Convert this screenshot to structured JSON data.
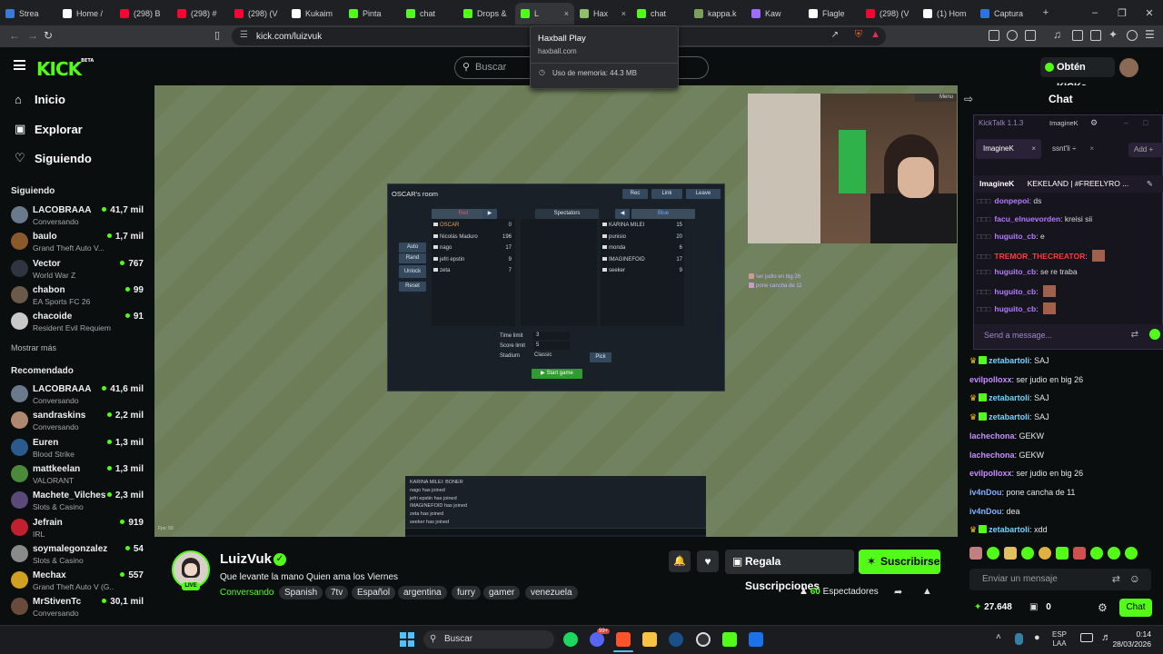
{
  "browser": {
    "tabs": [
      {
        "title": "Strea",
        "color": "#3a7bd5"
      },
      {
        "title": "Home /",
        "color": "#ffffff"
      },
      {
        "title": "(298) B",
        "color": "#ff0033"
      },
      {
        "title": "(298) #",
        "color": "#ff0033"
      },
      {
        "title": "(298) (V",
        "color": "#ff0033"
      },
      {
        "title": "Kukaim",
        "color": "#ffffff"
      },
      {
        "title": "Pinta",
        "color": "#53fc18"
      },
      {
        "title": "chat",
        "color": "#53fc18"
      },
      {
        "title": "Drops &",
        "color": "#53fc18"
      },
      {
        "title": "L",
        "color": "#53fc18"
      },
      {
        "title": "Hax",
        "color": "#8fbf6a"
      },
      {
        "title": "chat",
        "color": "#53fc18"
      },
      {
        "title": "kappa.k",
        "color": "#7aa05c"
      },
      {
        "title": "Kaw",
        "color": "#a06cff"
      },
      {
        "title": "Flagle",
        "color": "#ffffff"
      },
      {
        "title": "(298) (V",
        "color": "#ff0033"
      },
      {
        "title": "(1) Hom",
        "color": "#ffffff"
      },
      {
        "title": "Captura",
        "color": "#2b73e0"
      }
    ],
    "url": "kick.com/luizvuk",
    "tooltip": {
      "title": "Haxball Play",
      "domain": "haxball.com",
      "memory": "Uso de memoria: 44.3 MB"
    }
  },
  "header": {
    "search_placeholder": "Buscar",
    "obtain_label": "Obtén KICKs"
  },
  "sidebar": {
    "nav": [
      {
        "label": "Inicio",
        "icon": "home-icon"
      },
      {
        "label": "Explorar",
        "icon": "compass-icon"
      },
      {
        "label": "Siguiendo",
        "icon": "heart-icon"
      }
    ],
    "following_title": "Siguiendo",
    "following": [
      {
        "name": "LACOBRAAA",
        "category": "Conversando",
        "viewers": "41,7 mil",
        "color": "#6a7a8c"
      },
      {
        "name": "baulo",
        "category": "Grand Theft Auto V...",
        "viewers": "1,7 mil",
        "color": "#8b5a2b"
      },
      {
        "name": "Vector",
        "category": "World War Z",
        "viewers": "767",
        "color": "#2f3540"
      },
      {
        "name": "chabon",
        "category": "EA Sports FC 26",
        "viewers": "99",
        "color": "#6b5a4a"
      },
      {
        "name": "chacoide",
        "category": "Resident Evil Requiem",
        "viewers": "91",
        "color": "#c9c9c9"
      }
    ],
    "show_more": "Mostrar más",
    "recommended_title": "Recomendado",
    "recommended": [
      {
        "name": "LACOBRAAA",
        "category": "Conversando",
        "viewers": "41,6 mil",
        "color": "#6a7a8c"
      },
      {
        "name": "sandraskins",
        "category": "Conversando",
        "viewers": "2,2 mil",
        "color": "#b08870"
      },
      {
        "name": "Euren",
        "category": "Blood Strike",
        "viewers": "1,3 mil",
        "color": "#2a5b8c"
      },
      {
        "name": "mattkeelan",
        "category": "VALORANT",
        "viewers": "1,3 mil",
        "color": "#4a8a3a"
      },
      {
        "name": "Machete_Vilches",
        "category": "Slots & Casino",
        "viewers": "2,3 mil",
        "color": "#5a4a7a"
      },
      {
        "name": "Jefrain",
        "category": "IRL",
        "viewers": "919",
        "color": "#c02030"
      },
      {
        "name": "soymalegonzalez",
        "category": "Slots & Casino",
        "viewers": "54",
        "color": "#8a8a8a"
      },
      {
        "name": "Mechax",
        "category": "Grand Theft Auto V (G...",
        "viewers": "557",
        "color": "#d0a020"
      },
      {
        "name": "MrStivenTc",
        "category": "Conversando",
        "viewers": "30,1 mil",
        "color": "#6a4a3a"
      }
    ]
  },
  "haxball": {
    "room_title": "OSCAR's room",
    "room_buttons": [
      "Rec",
      "Link",
      "Leave"
    ],
    "red_label": "Red",
    "spectators_label": "Spectators",
    "blue_label": "Blue",
    "red_players": [
      {
        "name": "OSCAR",
        "score": "0"
      },
      {
        "name": "Nicolás Maduro",
        "score": "196"
      },
      {
        "name": "nago",
        "score": "17"
      },
      {
        "name": "jefri epstin",
        "score": "9"
      },
      {
        "name": "zeta",
        "score": "7"
      }
    ],
    "blue_players": [
      {
        "name": "KARINA MILEI",
        "score": "15"
      },
      {
        "name": "punisio",
        "score": "20"
      },
      {
        "name": "monda",
        "score": "6"
      },
      {
        "name": "IMAGINEFOID",
        "score": "17"
      },
      {
        "name": "seeker",
        "score": "9"
      }
    ],
    "side_buttons": [
      "Auto",
      "Rand",
      "Unlock",
      "Reset"
    ],
    "time_limit_label": "Time limit",
    "time_limit": "3",
    "score_limit_label": "Score limit",
    "score_limit": "5",
    "stadium_label": "Stadium",
    "stadium": "Classic",
    "pick_label": "Pick",
    "start_label": "Start game",
    "chat_lines": [
      "KARINA MILEI: BONER",
      "nago has joined",
      "jefri epstin has joined",
      "IMAGINEFOID has joined",
      "zeta has joined",
      "seeker has joined"
    ],
    "fps": "Fps: 59",
    "menu_label": "Menu",
    "cam_chat": [
      "ser judio en big 26",
      "pone cancha de 11"
    ]
  },
  "channel": {
    "name": "LuizVuk",
    "title": "Que levante la mano Quien ama los Viernes",
    "category": "Conversando",
    "tags": [
      "Spanish",
      "7tv",
      "Español",
      "argentina",
      "furry",
      "gamer",
      "venezuela"
    ],
    "gift_label": "Regala Suscripciones",
    "subscribe_label": "Suscribirse",
    "viewers": "60",
    "viewers_label": "Espectadores",
    "live_label": "LIVE"
  },
  "chat": {
    "title": "Chat",
    "kicktalk": {
      "title": "KickTalk 1.1.3",
      "account": "ImagineK",
      "tabs": [
        "ImagineK",
        "ssnt'li ÷"
      ],
      "add_label": "Add",
      "header": "ImagineK",
      "header_title": "KEKELAND | #FREELYRO ...",
      "messages": [
        {
          "user": "donpepoi",
          "text": "ds",
          "color": "#b37cff"
        },
        {
          "user": "facu_elnuevorden",
          "text": "kreisi sii",
          "color": "#b37cff"
        },
        {
          "user": "huguito_cb",
          "text": "e",
          "color": "#b37cff"
        },
        {
          "user": "TREMOR_THECREATOR",
          "text": "",
          "color": "#ff3b3b"
        },
        {
          "user": "huguito_cb",
          "text": "se re traba",
          "color": "#b37cff"
        },
        {
          "user": "huguito_cb",
          "text": "",
          "color": "#b37cff"
        },
        {
          "user": "huguito_cb",
          "text": "",
          "color": "#b37cff"
        }
      ],
      "send_placeholder": "Send a message..."
    },
    "messages": [
      {
        "user": "zetabartoli",
        "text": "SAJ",
        "color": "#6fd3ff"
      },
      {
        "user": "evilpolloxx",
        "text": "ser judio en big 26",
        "color": "#c78dff"
      },
      {
        "user": "zetabartoli",
        "text": "SAJ",
        "color": "#6fd3ff"
      },
      {
        "user": "zetabartoli",
        "text": "SAJ",
        "color": "#6fd3ff"
      },
      {
        "user": "lachechona",
        "text": "GEKW",
        "color": "#c78dff"
      },
      {
        "user": "lachechona",
        "text": "GEKW",
        "color": "#c78dff"
      },
      {
        "user": "evilpolloxx",
        "text": "ser judio en big 26",
        "color": "#c78dff"
      },
      {
        "user": "iv4nDou",
        "text": "pone cancha de 11",
        "color": "#7fb2ff"
      },
      {
        "user": "iv4nDou",
        "text": "dea",
        "color": "#7fb2ff"
      },
      {
        "user": "zetabartoli",
        "text": "xdd",
        "color": "#6fd3ff"
      }
    ],
    "input_placeholder": "Enviar un mensaje",
    "points": "27.648",
    "gifts": "0",
    "chat_button": "Chat"
  },
  "taskbar": {
    "search_placeholder": "Buscar",
    "lang": "ESP",
    "lang_sub": "LAA",
    "time": "0:14",
    "date": "28/03/2026",
    "discord_badge": "99+"
  }
}
